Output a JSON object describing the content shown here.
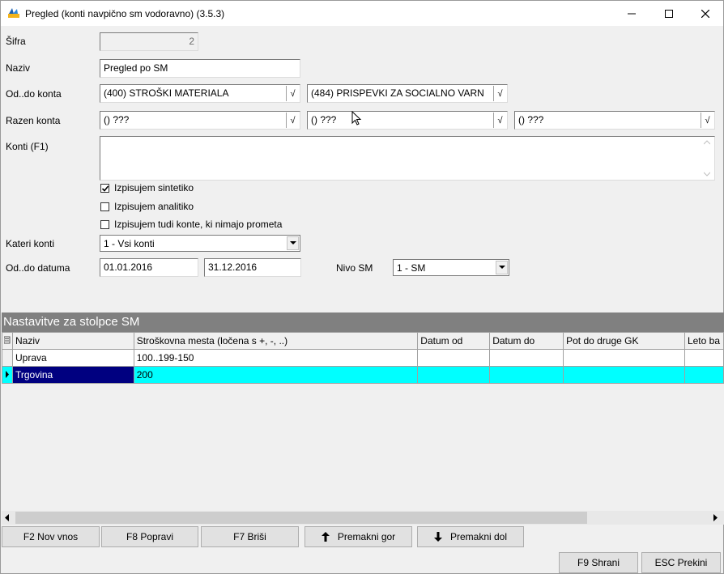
{
  "window": {
    "title": "Pregled (konti navpično sm vodoravno)  (3.5.3)"
  },
  "form": {
    "sifra": {
      "label": "Šifra",
      "value": "2"
    },
    "naziv": {
      "label": "Naziv",
      "value": "Pregled po SM"
    },
    "od_do_konta": {
      "label": "Od..do konta",
      "from": "(400) STROŠKI MATERIALA",
      "to": "(484) PRISPEVKI ZA SOCIALNO VARN"
    },
    "razen_konta": {
      "label": "Razen konta",
      "values": [
        "() ???",
        "() ???",
        "() ???"
      ]
    },
    "konti": {
      "label": "Konti (F1)"
    },
    "checkboxes": [
      {
        "label": "Izpisujem sintetiko",
        "checked": true
      },
      {
        "label": "Izpisujem analitiko",
        "checked": false
      },
      {
        "label": "Izpisujem tudi konte, ki nimajo prometa",
        "checked": false
      }
    ],
    "kateri_konti": {
      "label": "Kateri konti",
      "value": "1 - Vsi konti"
    },
    "od_do_datuma": {
      "label": "Od..do datuma",
      "from": "01.01.2016",
      "to": "31.12.2016"
    },
    "nivo_sm": {
      "label": "Nivo SM",
      "value": "1 - SM"
    }
  },
  "grid_section": {
    "title": "Nastavitve za stolpce SM",
    "columns": [
      "Naziv",
      "Stroškovna mesta (ločena s +, -, ..)",
      "Datum od",
      "Datum do",
      "Pot do druge GK",
      "Leto ba"
    ],
    "rows": [
      {
        "naziv": "Uprava",
        "sm": "100..199-150",
        "selected": false
      },
      {
        "naziv": "Trgovina",
        "sm": "200",
        "selected": true
      }
    ]
  },
  "buttons": {
    "nov_vnos": "F2 Nov vnos",
    "popravi": "F8 Popravi",
    "brisi": "F7 Briši",
    "premakni_gor": "Premakni gor",
    "premakni_dol": "Premakni dol",
    "shrani": "F9 Shrani",
    "prekini": "ESC Prekini"
  },
  "colors": {
    "selected_row": "#00ffff",
    "selected_name_cell": "#000080",
    "section_header": "#808080"
  }
}
